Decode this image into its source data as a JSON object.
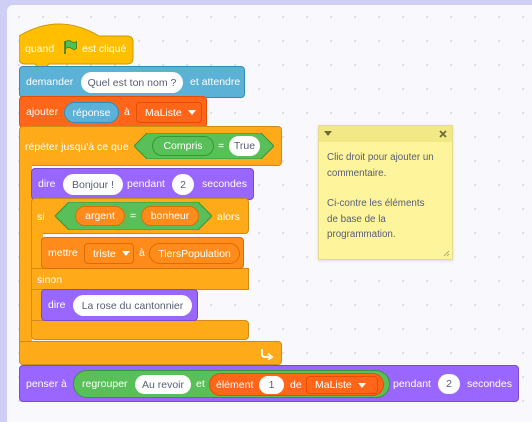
{
  "hat": {
    "label_before": "quand",
    "label_after": "est cliqué"
  },
  "ask": {
    "label": "demander",
    "value": "Quel est ton nom ?",
    "label_after": "et attendre"
  },
  "add": {
    "label": "ajouter",
    "reporter": "réponse",
    "label_mid": "à",
    "list": "MaListe"
  },
  "repeat": {
    "label": "répéter jusqu'à ce que",
    "left": "Compris",
    "op": "=",
    "right": "True"
  },
  "say_for": {
    "label": "dire",
    "value": "Bonjour !",
    "label_mid": "pendant",
    "seconds": "2",
    "label_after": "secondes"
  },
  "if": {
    "label": "si",
    "left": "argent",
    "op": "=",
    "right": "bonheur",
    "label_after": "alors"
  },
  "set_var": {
    "label": "mettre",
    "variable": "triste",
    "label_mid": "à",
    "value": "TiersPopulation"
  },
  "else": {
    "label": "sinon"
  },
  "say": {
    "label": "dire",
    "value": "La rose du cantonnier"
  },
  "think": {
    "label": "penser à",
    "join_label": "regrouper",
    "join_value": "Au revoir",
    "join_mid": "et",
    "item_label": "élément",
    "item_index": "1",
    "item_mid": "de",
    "item_list": "MaListe",
    "label_mid": "pendant",
    "seconds": "2",
    "label_after": "secondes"
  },
  "comment": {
    "line1": "Clic droit pour ajouter un",
    "line2": "commentaire.",
    "line3": "Ci-contre les éléments",
    "line4": "de base de la",
    "line5": "programmation."
  },
  "colors": {
    "events": "#ffbf00",
    "sensing": "#5cb1d6",
    "lists": "#ff661a",
    "control": "#ffab19",
    "operators": "#59c059",
    "looks": "#9966ff",
    "variables": "#ff8c1a"
  },
  "icons": [
    "green-flag-icon",
    "dropdown-caret-icon",
    "loop-arrow-icon",
    "collapse-icon",
    "close-icon",
    "resize-icon"
  ]
}
